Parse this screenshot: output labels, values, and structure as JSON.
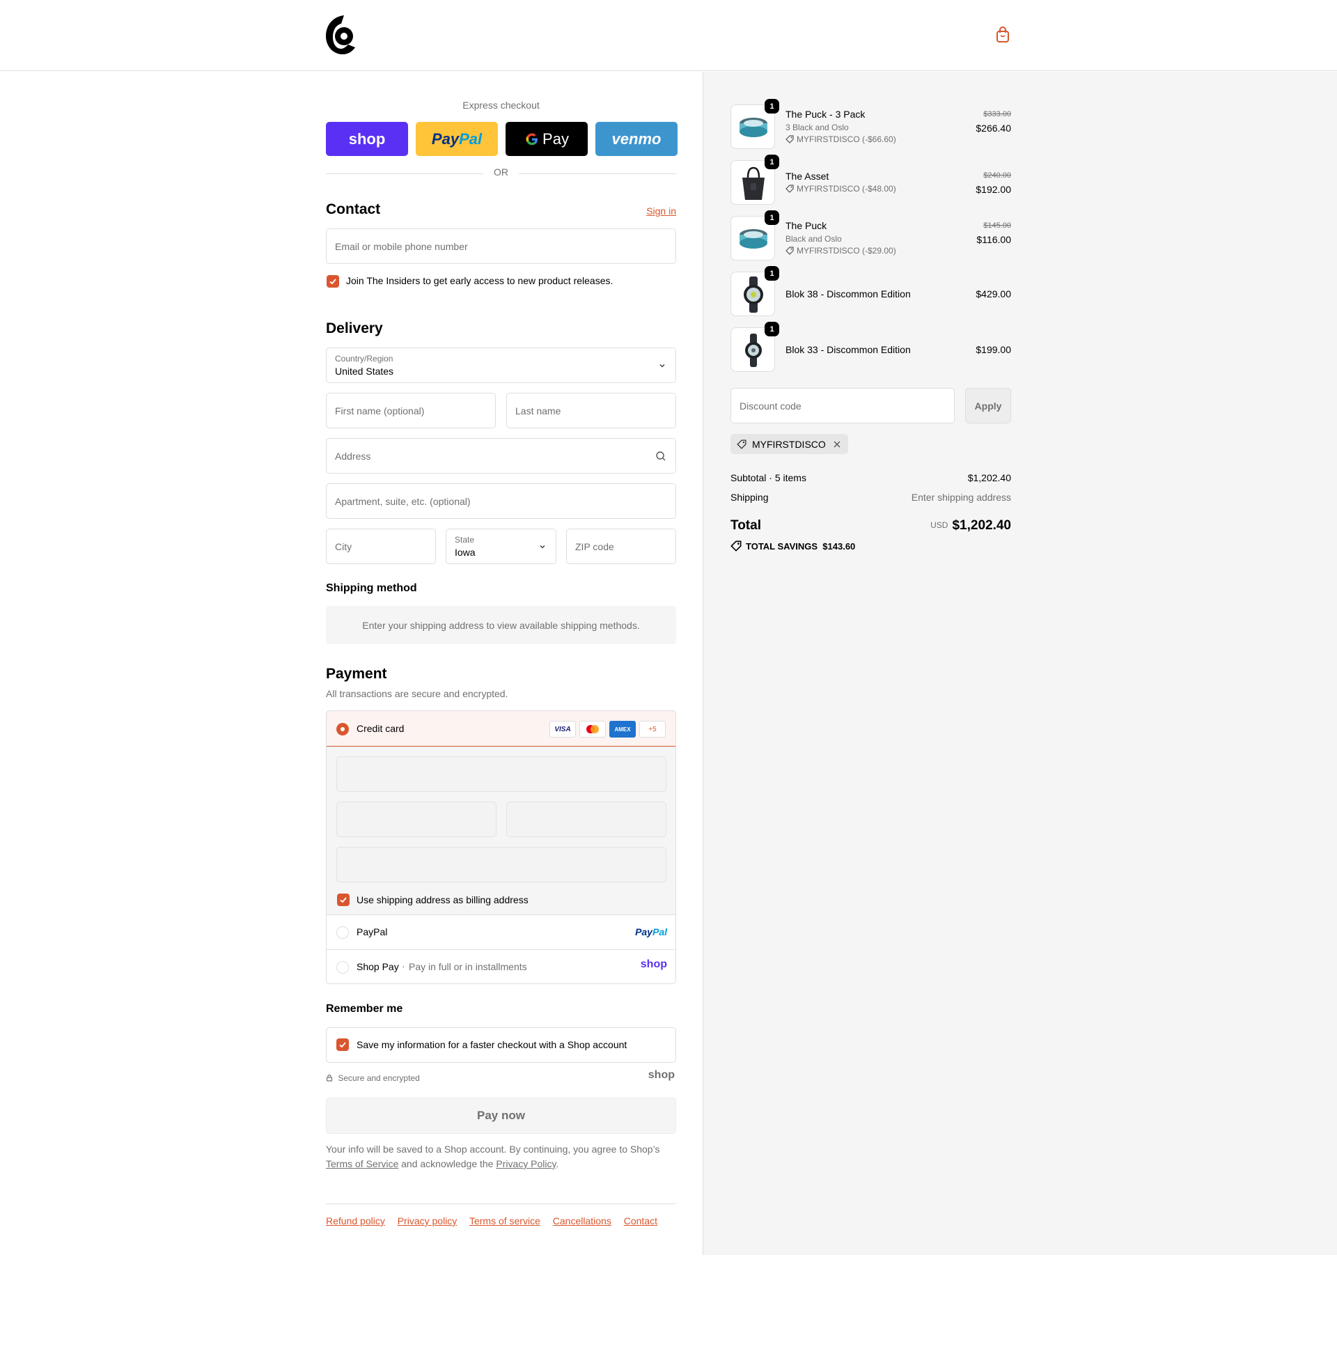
{
  "brand": {
    "accent": "#d9562e",
    "logo_icon": "brand-logo",
    "cart_icon": "shopping-bag-icon"
  },
  "express": {
    "title": "Express checkout",
    "buttons": {
      "shop": "shop",
      "paypal_pay": "Pay",
      "paypal_pal": "Pal",
      "gpay": "Pay",
      "venmo": "venmo"
    },
    "or": "OR"
  },
  "contact": {
    "heading": "Contact",
    "sign_in": "Sign in",
    "email_placeholder": "Email or mobile phone number",
    "newsletter_label": "Join The Insiders to get early access to new product releases."
  },
  "delivery": {
    "heading": "Delivery",
    "country_label": "Country/Region",
    "country_value": "United States",
    "first_name_placeholder": "First name (optional)",
    "last_name_placeholder": "Last name",
    "address_placeholder": "Address",
    "apartment_placeholder": "Apartment, suite, etc. (optional)",
    "city_placeholder": "City",
    "state_label": "State",
    "state_value": "Iowa",
    "zip_placeholder": "ZIP code"
  },
  "shipping_method": {
    "heading": "Shipping method",
    "info": "Enter your shipping address to view available shipping methods."
  },
  "payment": {
    "heading": "Payment",
    "subheading": "All transactions are secure and encrypted.",
    "credit_card_label": "Credit card",
    "card_brands": [
      "VISA",
      "MC",
      "AMEX",
      "+5"
    ],
    "billing_label": "Use shipping address as billing address",
    "paypal_label": "PayPal",
    "paypal_logo_pay": "Pay",
    "paypal_logo_pal": "Pal",
    "shop_pay_label": "Shop Pay",
    "shop_pay_sub": "Pay in full or in installments",
    "shop_logo": "shop"
  },
  "remember": {
    "heading": "Remember me",
    "label": "Save my information for a faster checkout with a Shop account",
    "secure": "Secure and encrypted",
    "shop_logo": "shop"
  },
  "pay_now": "Pay now",
  "legal": {
    "text1": "Your info will be saved to a Shop account. By continuing, you agree to Shop’s",
    "terms": "Terms of Service",
    "text2": " and acknowledge the ",
    "privacy": "Privacy Policy",
    "text3": "."
  },
  "footer_links": [
    "Refund policy",
    "Privacy policy",
    "Terms of service",
    "Cancellations",
    "Contact"
  ],
  "cart_items": [
    {
      "name": "The Puck - 3 Pack",
      "variant": "3 Black and Oslo",
      "discount": "MYFIRSTDISCO (-$66.60)",
      "old_price": "$333.00",
      "price": "$266.40",
      "qty": "1"
    },
    {
      "name": "The Asset",
      "variant": "",
      "discount": "MYFIRSTDISCO (-$48.00)",
      "old_price": "$240.00",
      "price": "$192.00",
      "qty": "1"
    },
    {
      "name": "The Puck",
      "variant": "Black and Oslo",
      "discount": "MYFIRSTDISCO (-$29.00)",
      "old_price": "$145.00",
      "price": "$116.00",
      "qty": "1"
    },
    {
      "name": "Blok 38 - Discommon Edition",
      "variant": "",
      "discount": "",
      "old_price": "",
      "price": "$429.00",
      "qty": "1"
    },
    {
      "name": "Blok 33 - Discommon Edition",
      "variant": "",
      "discount": "",
      "old_price": "",
      "price": "$199.00",
      "qty": "1"
    }
  ],
  "discount": {
    "placeholder": "Discount code",
    "apply": "Apply",
    "applied_code": "MYFIRSTDISCO"
  },
  "summary": {
    "subtotal_label": "Subtotal · 5 items",
    "subtotal_value": "$1,202.40",
    "shipping_label": "Shipping",
    "shipping_value": "Enter shipping address",
    "total_label": "Total",
    "currency": "USD",
    "total_value": "$1,202.40",
    "savings_label": "TOTAL SAVINGS",
    "savings_value": "$143.60"
  }
}
